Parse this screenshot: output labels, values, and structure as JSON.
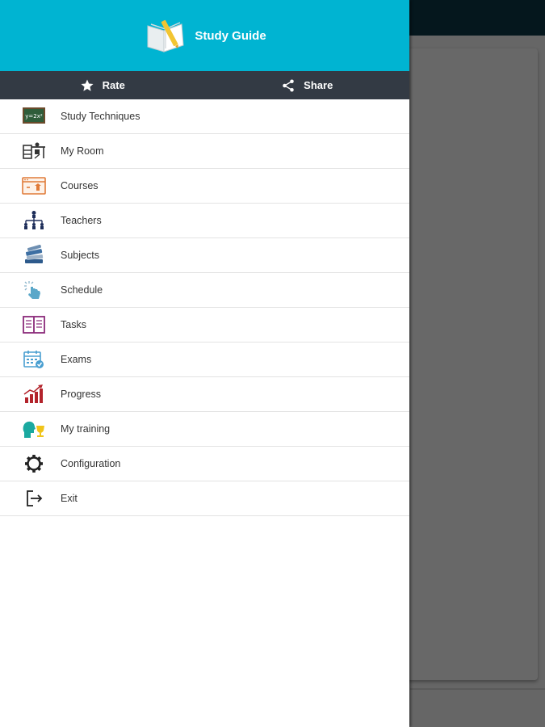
{
  "app": {
    "title": "Study Guide"
  },
  "actions": {
    "rate_label": "Rate",
    "share_label": "Share"
  },
  "menu": {
    "items": [
      {
        "label": "Study Techniques",
        "icon": "chalkboard-icon"
      },
      {
        "label": "My Room",
        "icon": "desk-icon"
      },
      {
        "label": "Courses",
        "icon": "course-window-icon"
      },
      {
        "label": "Teachers",
        "icon": "hierarchy-icon"
      },
      {
        "label": "Subjects",
        "icon": "books-stack-icon"
      },
      {
        "label": "Schedule",
        "icon": "tap-clock-icon"
      },
      {
        "label": "Tasks",
        "icon": "notebook-icon"
      },
      {
        "label": "Exams",
        "icon": "calendar-check-icon"
      },
      {
        "label": "Progress",
        "icon": "bar-chart-up-icon"
      },
      {
        "label": "My training",
        "icon": "head-trophy-icon"
      },
      {
        "label": "Configuration",
        "icon": "gear-icon"
      },
      {
        "label": "Exit",
        "icon": "exit-icon"
      }
    ]
  },
  "colors": {
    "header": "#00b4d2",
    "action_bar": "#333a44",
    "status_bar": "#05171d",
    "scrim": "#666666"
  }
}
